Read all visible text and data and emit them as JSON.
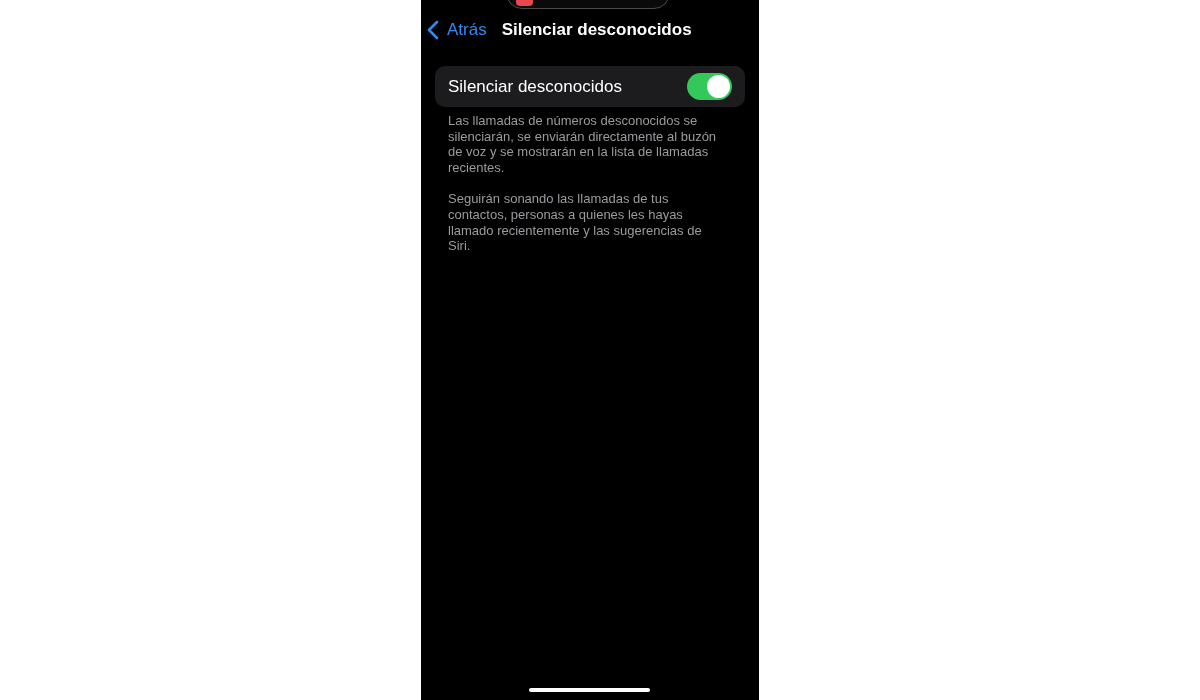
{
  "nav": {
    "back_label": "Atrás",
    "title": "Silenciar desconocidos"
  },
  "setting": {
    "label": "Silenciar desconocidos",
    "on": true
  },
  "footer_paragraphs": [
    "Las llamadas de números desconocidos se silenciarán, se enviarán directamente al buzón de voz y se mostrarán en la lista de llamadas recientes.",
    "Seguirán sonando las llamadas de tus contactos, personas a quienes les hayas llamado recientemente y las sugerencias de Siri."
  ]
}
